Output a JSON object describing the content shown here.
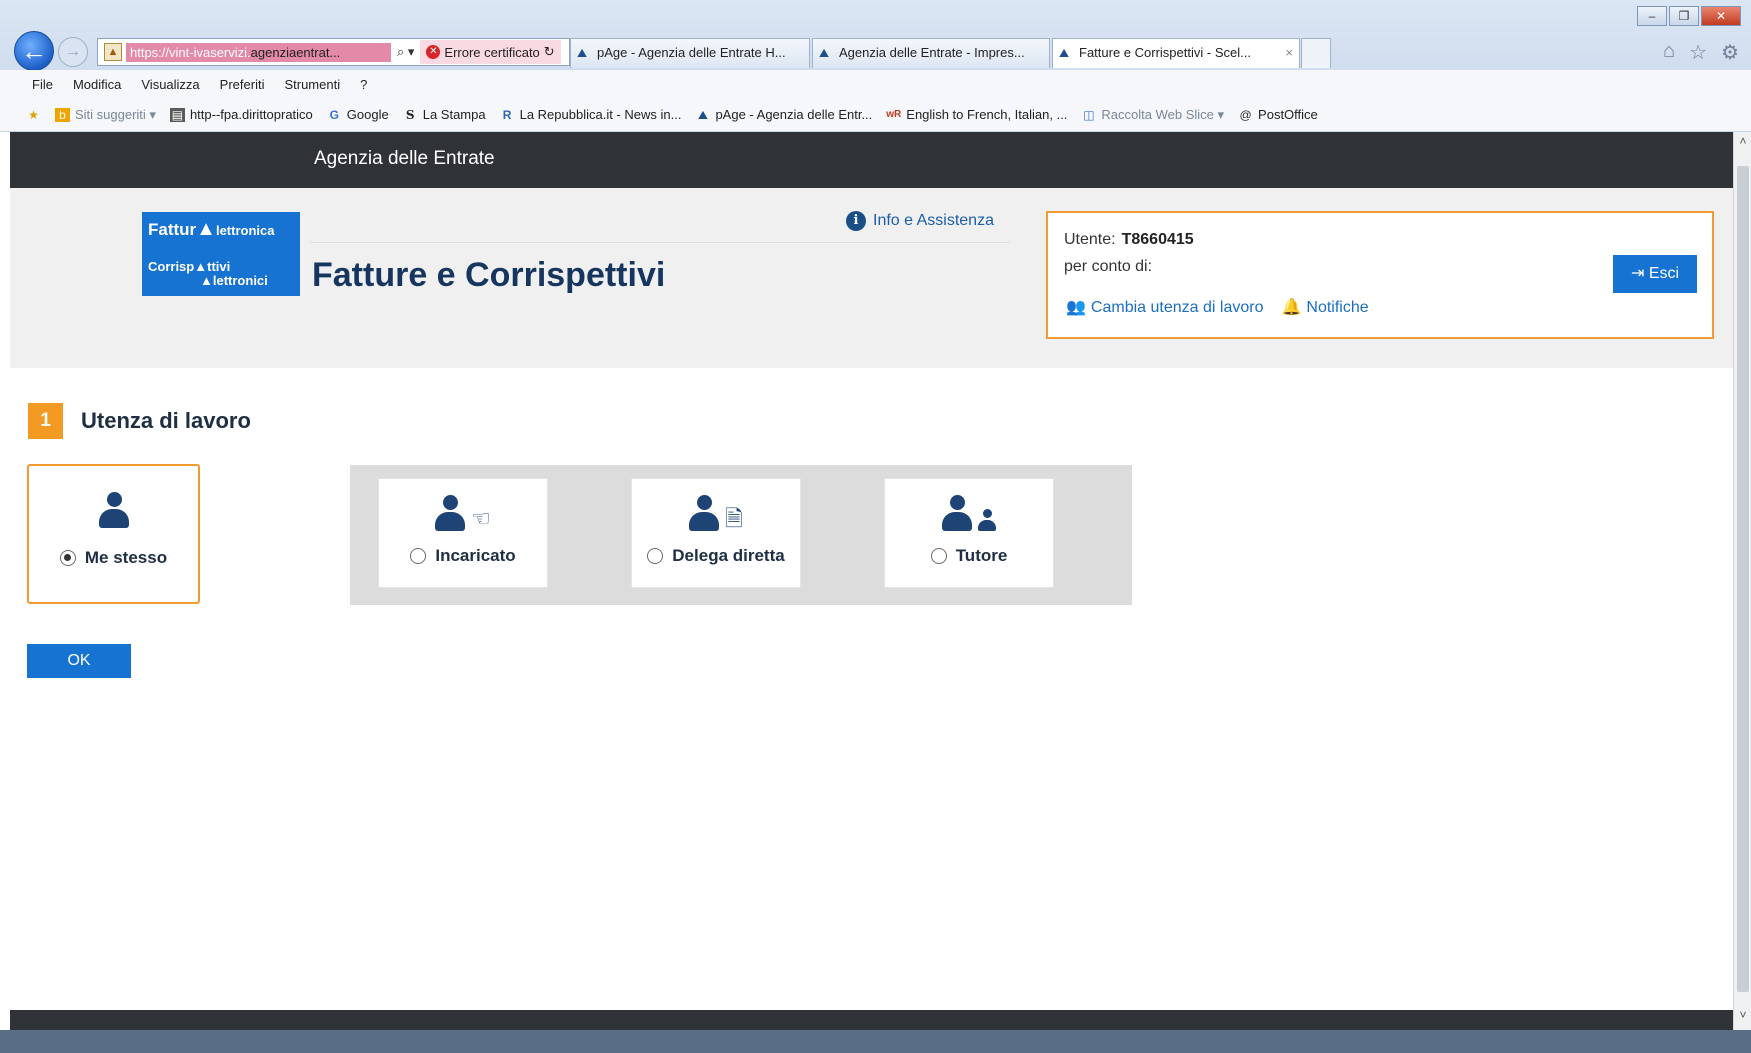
{
  "browser": {
    "address_url_prefix": "https://vint-ivaservizi.",
    "address_url_domain": "agenziaentrat...",
    "address_search_glyph": "⌕ ▾",
    "cert_error": "Errore certificato",
    "tabs": [
      {
        "label": "pAge - Agenzia delle Entrate H...",
        "active": false
      },
      {
        "label": "Agenzia delle Entrate - Impres...",
        "active": false
      },
      {
        "label": "Fatture e Corrispettivi - Scel...",
        "active": true
      }
    ],
    "tab_close": "×",
    "menu": [
      "File",
      "Modifica",
      "Visualizza",
      "Preferiti",
      "Strumenti",
      "?"
    ],
    "favorites": [
      {
        "label": "Siti suggeriti ▾",
        "icon": "bing-icon",
        "muted": true
      },
      {
        "label": "http--fpa.dirittopratico",
        "icon": "page-icon",
        "muted": false
      },
      {
        "label": "Google",
        "icon": "google-icon",
        "muted": false
      },
      {
        "label": "La Stampa",
        "icon": "lastampa-icon",
        "muted": false
      },
      {
        "label": "La Repubblica.it - News in...",
        "icon": "repubblica-icon",
        "muted": false
      },
      {
        "label": "pAge - Agenzia delle Entr...",
        "icon": "agenzia-icon",
        "muted": false
      },
      {
        "label": "English to French, Italian, ...",
        "icon": "wordreference-icon",
        "muted": false
      },
      {
        "label": "Raccolta Web Slice ▾",
        "icon": "webslice-icon",
        "muted": true
      },
      {
        "label": "PostOffice",
        "icon": "postoffice-icon",
        "muted": false
      }
    ]
  },
  "site": {
    "agency": "Agenzia delle Entrate",
    "logo": {
      "line1_a": "Fattur",
      "line1_b": "lettronica",
      "line2_a": "Corrisp",
      "line2_b": "ttivi",
      "line2_c": "lettronici"
    },
    "app_title": "Fatture e Corrispettivi",
    "info_link": "Info e Assistenza",
    "user": {
      "utente_label": "Utente:",
      "utente_value": "T8660415",
      "per_conto_label": "per conto di:",
      "cambia_link": "Cambia utenza di lavoro",
      "notifiche_link": "Notifiche",
      "esci_label": "Esci"
    }
  },
  "step": {
    "number": "1",
    "title": "Utenza di lavoro"
  },
  "options": [
    {
      "label": "Me stesso",
      "selected": true,
      "icon": "user-icon"
    },
    {
      "label": "Incaricato",
      "selected": false,
      "icon": "user-hand-icon"
    },
    {
      "label": "Delega diretta",
      "selected": false,
      "icon": "user-document-icon"
    },
    {
      "label": "Tutore",
      "selected": false,
      "icon": "user-child-icon"
    }
  ],
  "ok_label": "OK",
  "colors": {
    "accent_orange": "#f19b32",
    "primary_blue": "#1673d1",
    "dark_bar": "#2f3338",
    "title_navy": "#16365f"
  }
}
